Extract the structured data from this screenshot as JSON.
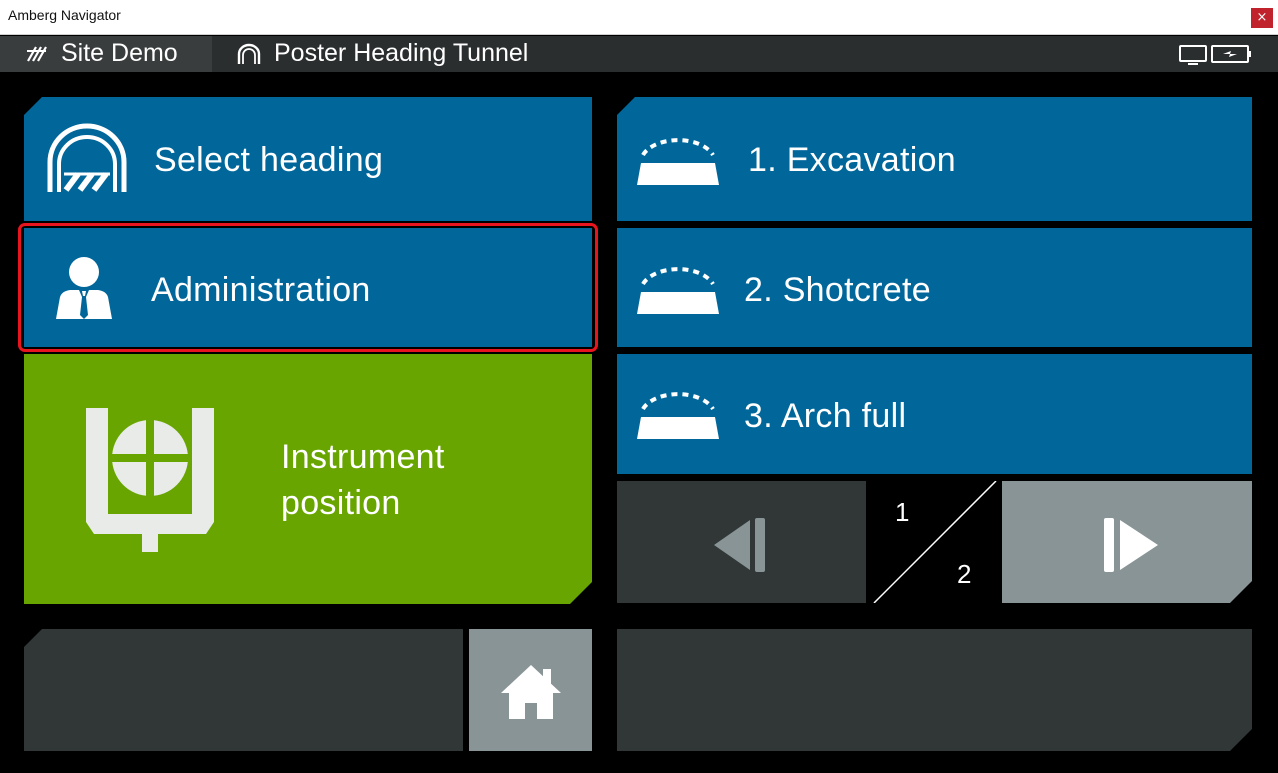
{
  "window": {
    "title": "Amberg Navigator",
    "close_symbol": "×"
  },
  "header": {
    "site_label": "Site Demo",
    "tunnel_label": "Poster Heading Tunnel",
    "site_icon": "site-icon",
    "tunnel_icon": "tunnel-icon",
    "status_icons": [
      "monitor-icon",
      "battery-charging-icon"
    ]
  },
  "menu": {
    "select_heading": "Select heading",
    "administration": "Administration",
    "instrument_line1": "Instrument",
    "instrument_line2": "position"
  },
  "phases": [
    {
      "label": "1. Excavation"
    },
    {
      "label": "2. Shotcrete"
    },
    {
      "label": "3. Arch full"
    }
  ],
  "pager": {
    "current": "1",
    "total": "2"
  },
  "colors": {
    "tile_blue": "#01679b",
    "tile_green": "#68a500",
    "tile_dark": "#313637",
    "tile_grey": "#889495",
    "highlight": "#e8141e"
  }
}
